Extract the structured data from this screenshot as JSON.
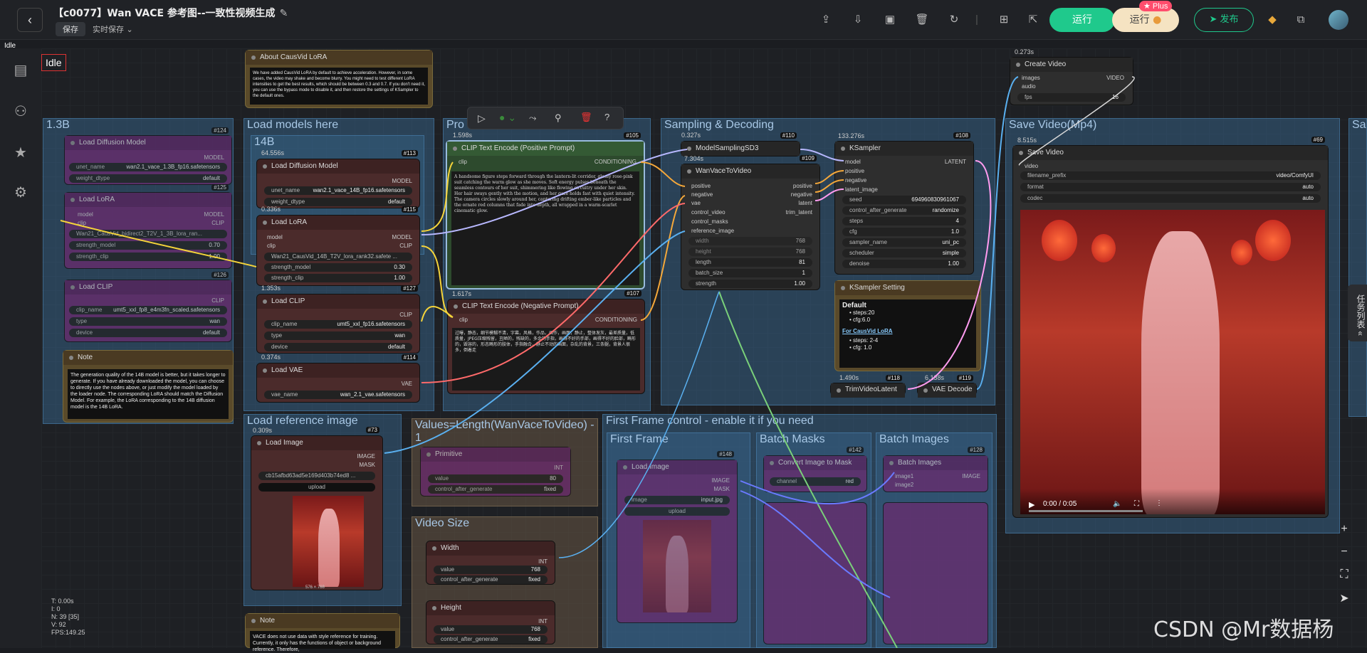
{
  "header": {
    "title": "【c0077】Wan VACE 参考图--一致性视频生成",
    "save_label": "保存",
    "autosave_label": "实时保存",
    "run_label": "运行",
    "run2_label": "运行",
    "plus_badge": "Plus",
    "publish_label": "发布"
  },
  "status": "Idle",
  "canvas_status": "Idle",
  "groups": {
    "g13b": "1.3B",
    "load_models": "Load models here",
    "prompt": "Pro",
    "sampling": "Sampling & Decoding",
    "save_video": "Save Video(Mp4)",
    "load_ref": "Load reference image",
    "values": "Values=Length(WanVaceToVideo) - 1",
    "video_size": "Video Size",
    "first_frame_ctrl": "First Frame control - enable it if you need",
    "first_frame": "First Frame",
    "batch_masks": "Batch Masks",
    "batch_images": "Batch Images",
    "g14b": "14B",
    "sa": "Sa"
  },
  "nodes": {
    "about": {
      "title": "About CausVid LoRA",
      "text": "We have added CausVid LoRA by default to achieve acceleration. However, in some cases, the video may shake and become blurry. You might need to test different LoRA intensities to get the best results, which should be between 0.3 and 0.7. If you don't need it, you can use the bypass mode to disable it, and then restore the settings of KSampler to the default ones."
    },
    "ldm": {
      "title": "Load Diffusion Model",
      "badge": "#113",
      "time": "64.556s",
      "out": "MODEL",
      "w1k": "unet_name",
      "w1v": "wan2.1_vace_14B_fp16.safetensors",
      "w2k": "weight_dtype",
      "w2v": "default"
    },
    "lora": {
      "title": "Load LoRA",
      "badge": "#115",
      "time": "0.336s",
      "in1": "model",
      "in2": "clip",
      "out1": "MODEL",
      "out2": "CLIP",
      "w1v": "Wan21_CausVid_14B_T2V_lora_rank32.safete ...",
      "w2k": "strength_model",
      "w2v": "0.30",
      "w3k": "strength_clip",
      "w3v": "1.00"
    },
    "clip": {
      "title": "Load CLIP",
      "badge": "#127",
      "time": "1.353s",
      "out": "CLIP",
      "w1k": "clip_name",
      "w1v": "umt5_xxl_fp16.safetensors",
      "w2k": "type",
      "w2v": "wan",
      "w3k": "device",
      "w3v": "default"
    },
    "vae": {
      "title": "Load VAE",
      "badge": "#114",
      "time": "0.374s",
      "out": "VAE",
      "w1k": "vae_name",
      "w1v": "wan_2.1_vae.safetensors"
    },
    "pos": {
      "title": "CLIP Text Encode (Positive Prompt)",
      "badge": "#105",
      "time": "1.598s",
      "in": "clip",
      "out": "CONDITIONING",
      "text": "A handsome figure steps forward through the lantern-lit corridor, glossy rose-pink suit catching the warm glow as she moves. Soft energy pulses beneath the seamless contours of her suit, shimmering like flowing circuitry under her skin. Her hair sways gently with the motion, and her gaze holds fast with quiet intensity. The camera circles slowly around her, capturing drifting ember-like particles and the ornate red columns that fade into depth, all wrapped in a warm-scarlet cinematic glow."
    },
    "neg": {
      "title": "CLIP Text Encode (Negative Prompt)",
      "badge": "#107",
      "time": "1.617s",
      "in": "clip",
      "out": "CONDITIONING",
      "text": "过曝，静态，细节模糊不清，字幕，风格，作品，画作，画面，静止，整体发灰，最差质量，低质量，JPEG压缩残留，丑陋的，残缺的，多余的手指，画得不好的手部，画得不好的脸部，畸形的，毁容的，形态畸形的肢体，手指融合，静止不动的画面，杂乱的背景，三条腿，背景人很多，倒着走"
    },
    "msd": {
      "title": "ModelSamplingSD3",
      "badge": "#110",
      "time": "0.327s"
    },
    "wvtv": {
      "title": "WanVaceToVideo",
      "badge": "#109",
      "time": "7.304s",
      "i1": "positive",
      "i2": "negative",
      "i3": "vae",
      "i4": "control_video",
      "i5": "control_masks",
      "i6": "reference_image",
      "o1": "positive",
      "o2": "negative",
      "o3": "latent",
      "o4": "trim_latent",
      "w1k": "width",
      "w1v": "768",
      "w2k": "height",
      "w2v": "768",
      "w3k": "length",
      "w3v": "81",
      "w4k": "batch_size",
      "w4v": "1",
      "w5k": "strength",
      "w5v": "1.00"
    },
    "ks": {
      "title": "KSampler",
      "badge": "#108",
      "time": "133.276s",
      "i1": "model",
      "i2": "positive",
      "i3": "negative",
      "i4": "latent_image",
      "out": "LATENT",
      "w1k": "seed",
      "w1v": "694960830961067",
      "w2k": "control_after_generate",
      "w2v": "randomize",
      "w3k": "steps",
      "w3v": "4",
      "w4k": "cfg",
      "w4v": "1.0",
      "w5k": "sampler_name",
      "w5v": "uni_pc",
      "w6k": "scheduler",
      "w6v": "simple",
      "w7k": "denoise",
      "w7v": "1.00"
    },
    "kss": {
      "title": "KSampler Setting",
      "h": "Default",
      "l1": "steps:20",
      "l2": "cfg:6.0",
      "link": "For CausVid LoRA",
      "l3": "steps: 2-4",
      "l4": "cfg: 1.0"
    },
    "trim": {
      "title": "TrimVideoLatent",
      "badge": "#118",
      "time": "1.490s"
    },
    "vaed": {
      "title": "VAE Decode",
      "badge": "#119",
      "time": "6.138s"
    },
    "cv": {
      "title": "Create Video",
      "time": "0.273s",
      "in1": "images",
      "in2": "audio",
      "out": "VIDEO",
      "w1k": "fps",
      "w1v": "16"
    },
    "sv": {
      "title": "Save Video",
      "badge": "#69",
      "time": "8.515s",
      "in": "video",
      "w1k": "filename_prefix",
      "w1v": "video/ComfyUI",
      "w2k": "format",
      "w2v": "auto",
      "w3k": "codec",
      "w3v": "auto",
      "player": "0:00 / 0:05"
    },
    "li": {
      "title": "Load Image",
      "badge": "#73",
      "time": "0.309s",
      "o1": "IMAGE",
      "o2": "MASK",
      "w1v": "cb15afbd63ad5e169d403b74ed8 ...",
      "upload": "upload",
      "dims": "576 × 768"
    },
    "width": {
      "title": "Width",
      "out": "INT",
      "w1k": "value",
      "w1v": "768",
      "w2k": "control_after_generate",
      "w2v": "fixed"
    },
    "height": {
      "title": "Height",
      "out": "INT",
      "w1k": "value",
      "w1v": "768",
      "w2k": "control_after_generate",
      "w2v": "fixed"
    },
    "note1": {
      "title": "Note",
      "text": "The generation quality of the 14B model is better, but it takes longer to generate. If you have already downloaded the model, you can choose to directly use the nodes above, or just modify the model loaded by the loader node. The corresponding LoRA should match the Diffusion Model. For example, the LoRA corresponding to the 14B diffusion model is the 14B LoRA."
    },
    "note2": {
      "title": "Note",
      "text": "VACE does not use data with style reference for training. Currently, it only has the functions of object or background reference. Therefore,"
    },
    "prim": {
      "title": "Primitive",
      "out": "INT",
      "w1k": "value",
      "w1v": "80",
      "w2k": "control_after_generate",
      "w2v": "fixed"
    },
    "li2": {
      "title": "Load Image",
      "o1": "IMAGE",
      "o2": "MASK",
      "w1k": "image",
      "w1v": "input.jpg",
      "upload": "upload"
    },
    "p13ldm": {
      "title": "Load Diffusion Model",
      "badge": "#124",
      "out": "MODEL",
      "w1k": "unet_name",
      "w1v": "wan2.1_vace_1.3B_fp16.safetensors",
      "w2k": "weight_dtype",
      "w2v": "default"
    },
    "p13lora": {
      "title": "Load LoRA",
      "badge": "#125",
      "out1": "MODEL",
      "out2": "CLIP",
      "in1": "model",
      "in2": "clip",
      "w1v": "Wan21_CausVid_bidirect2_T2V_1_3B_lora_ran...",
      "w2k": "strength_model",
      "w2v": "0.70",
      "w3k": "strength_clip",
      "w3v": "1.00"
    },
    "p13clip": {
      "title": "Load CLIP",
      "badge": "#126",
      "out": "CLIP",
      "w1k": "clip_name",
      "w1v": "umt5_xxl_fp8_e4m3fn_scaled.safetensors",
      "w2k": "type",
      "w2v": "wan",
      "w3k": "device",
      "w3v": "default"
    },
    "bm1": {
      "title": "Convert Image to Mask",
      "badge": "#142",
      "w1k": "channel",
      "w1v": "red"
    },
    "bi1": {
      "title": "Batch Images",
      "badge": "#128",
      "i1": "image1",
      "i2": "image2",
      "out": "IMAGE"
    },
    "ffbadge": "#148"
  },
  "stats": {
    "t": "T: 0.00s",
    "i": "I: 0",
    "n": "N: 39 [35]",
    "v": "V: 92",
    "fps": "FPS:149.25"
  },
  "tasklist": "任务列表",
  "watermark": "CSDN @Mr数据杨"
}
